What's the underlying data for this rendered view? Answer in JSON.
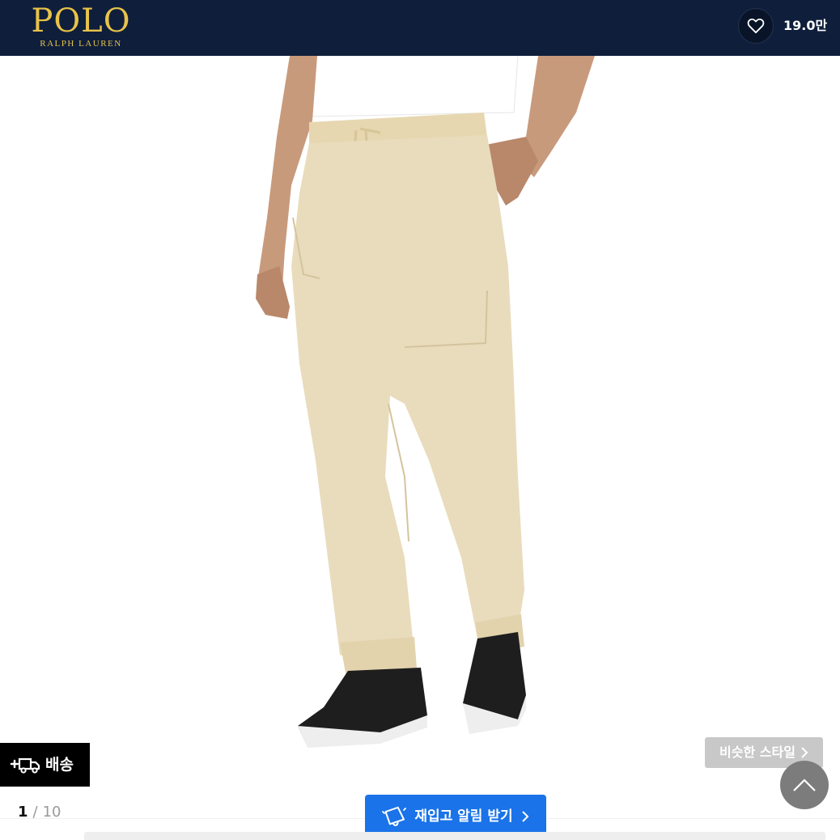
{
  "header": {
    "brand_main": "POLO",
    "brand_sub": "RALPH LAUREN",
    "like_count": "19.0만",
    "brand_color": "#e8c34a",
    "bg_color": "#0f1e3b"
  },
  "image": {
    "icon": "product-photo"
  },
  "shipping_badge": {
    "label": "배송",
    "icon": "delivery-truck-icon"
  },
  "similar_style": {
    "label": "비슷한 스타일",
    "icon": "chevron-right-icon"
  },
  "pager": {
    "current": "1",
    "separator": "/",
    "total": "10"
  },
  "restock": {
    "label": "재입고 알림 받기",
    "icon": "bell-icon",
    "color": "#1a73e8"
  },
  "scroll_top": {
    "icon": "chevron-up-icon"
  }
}
